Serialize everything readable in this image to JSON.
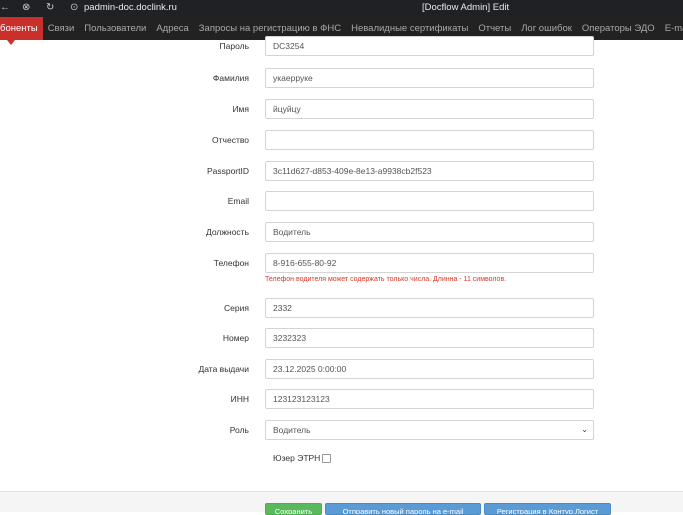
{
  "browser": {
    "url": "padmin-doc.doclink.ru",
    "window_title": "[Docflow Admin] Edit"
  },
  "nav": {
    "items": [
      {
        "label": "боненты",
        "active": true
      },
      {
        "label": "Связи"
      },
      {
        "label": "Пользователи"
      },
      {
        "label": "Адреса"
      },
      {
        "label": "Запросы на регистрацию в ФНС"
      },
      {
        "label": "Невалидные сертификаты"
      },
      {
        "label": "Отчеты"
      },
      {
        "label": "Лог ошибок"
      },
      {
        "label": "Операторы ЭДО"
      },
      {
        "label": "E-mail поставщиков"
      }
    ]
  },
  "form": {
    "password": {
      "label": "Пароль",
      "value": "DC3254"
    },
    "lastname": {
      "label": "Фамилия",
      "value": "укаерруке"
    },
    "firstname": {
      "label": "Имя",
      "value": "йцуйцу"
    },
    "middlename": {
      "label": "Отчество",
      "value": ""
    },
    "passport_id": {
      "label": "PassportID",
      "value": "3c11d627-d853-409e-8e13-a9938cb2f523"
    },
    "email": {
      "label": "Email",
      "value": ""
    },
    "position": {
      "label": "Должность",
      "value": "Водитель"
    },
    "phone": {
      "label": "Телефон",
      "value": "8-916-655-80-92",
      "error": "Телефон водителя может содержать только числа. Длинна - 11 символов."
    },
    "series": {
      "label": "Серия",
      "value": "2332"
    },
    "number": {
      "label": "Номер",
      "value": "3232323"
    },
    "issue_date": {
      "label": "Дата выдачи",
      "value": "23.12.2025 0:00:00"
    },
    "inn": {
      "label": "ИНН",
      "value": "123123123123"
    },
    "role": {
      "label": "Роль",
      "value": "Водитель"
    },
    "etrn_user": {
      "label": "Юзер ЭТРН",
      "checked": false
    }
  },
  "buttons": {
    "save": "Сохранить",
    "send_password": "Отправить новый пароль на e-mail",
    "register": "Регистрация в Контур.Логист"
  },
  "colors": {
    "navbar_bg": "#222222",
    "active_tab": "#c9302c",
    "error_text": "#d9392b",
    "save_button": "#5cb85c",
    "action_button": "#5b9bd5"
  }
}
